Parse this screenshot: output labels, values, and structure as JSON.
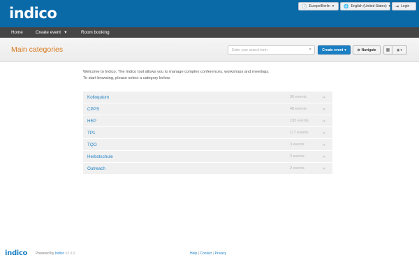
{
  "header": {
    "logo_text": "indico",
    "timezone": "Europe/Berlin",
    "language": "English (United States)",
    "login": "Login"
  },
  "nav": {
    "home": "Home",
    "create_event": "Create event",
    "room_booking": "Room booking"
  },
  "titlebar": {
    "title": "Main categories",
    "search_placeholder": "Enter your search term",
    "create_event_button": "Create event",
    "navigate_button": "Navigate"
  },
  "intro": {
    "line1": "Welcome to Indico. The Indico tool allows you to manage complex conferences, workshops and meetings.",
    "line2": "To start browsing, please select a category below."
  },
  "categories": [
    {
      "name": "Kolloquium",
      "count": "36 events"
    },
    {
      "name": "CPPS",
      "count": "48 events"
    },
    {
      "name": "HEP",
      "count": "192 events"
    },
    {
      "name": "TP1",
      "count": "117 events"
    },
    {
      "name": "TQO",
      "count": "3 events"
    },
    {
      "name": "Herbstschule",
      "count": "3 events"
    },
    {
      "name": "Outreach",
      "count": "2 events"
    }
  ],
  "footer": {
    "logo_text": "indico",
    "powered_by": "Powered by",
    "powered_name": "Indico",
    "version": "v3.3.0",
    "help": "Help",
    "contact": "Contact",
    "privacy": "Privacy",
    "separator": "|"
  },
  "colors": {
    "header_blue": "#0a6aa8",
    "nav_dark": "#454545",
    "title_orange": "#d77a1f",
    "link_blue": "#1a7fc4"
  }
}
